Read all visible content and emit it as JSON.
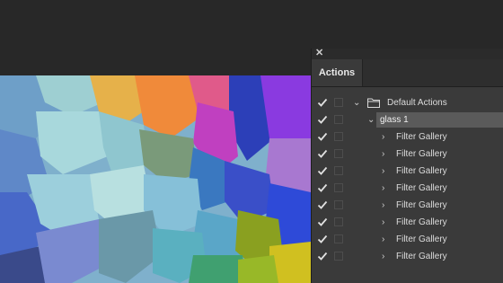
{
  "panel": {
    "close_glyph": "✕",
    "tab_label": "Actions"
  },
  "actions": {
    "set_name": "Default Actions",
    "action_name": "glass 1",
    "steps": [
      {
        "label": "Filter Gallery"
      },
      {
        "label": "Filter Gallery"
      },
      {
        "label": "Filter Gallery"
      },
      {
        "label": "Filter Gallery"
      },
      {
        "label": "Filter Gallery"
      },
      {
        "label": "Filter Gallery"
      },
      {
        "label": "Filter Gallery"
      },
      {
        "label": "Filter Gallery"
      }
    ]
  },
  "icons": {
    "check": "check-icon",
    "folder": "folder-icon",
    "chevron_down": "chevron-down-icon",
    "chevron_right": "chevron-right-icon"
  },
  "colors": {
    "panel_bg": "#3a3a3a",
    "app_bg": "#282828",
    "selection": "#5a5a5a"
  }
}
